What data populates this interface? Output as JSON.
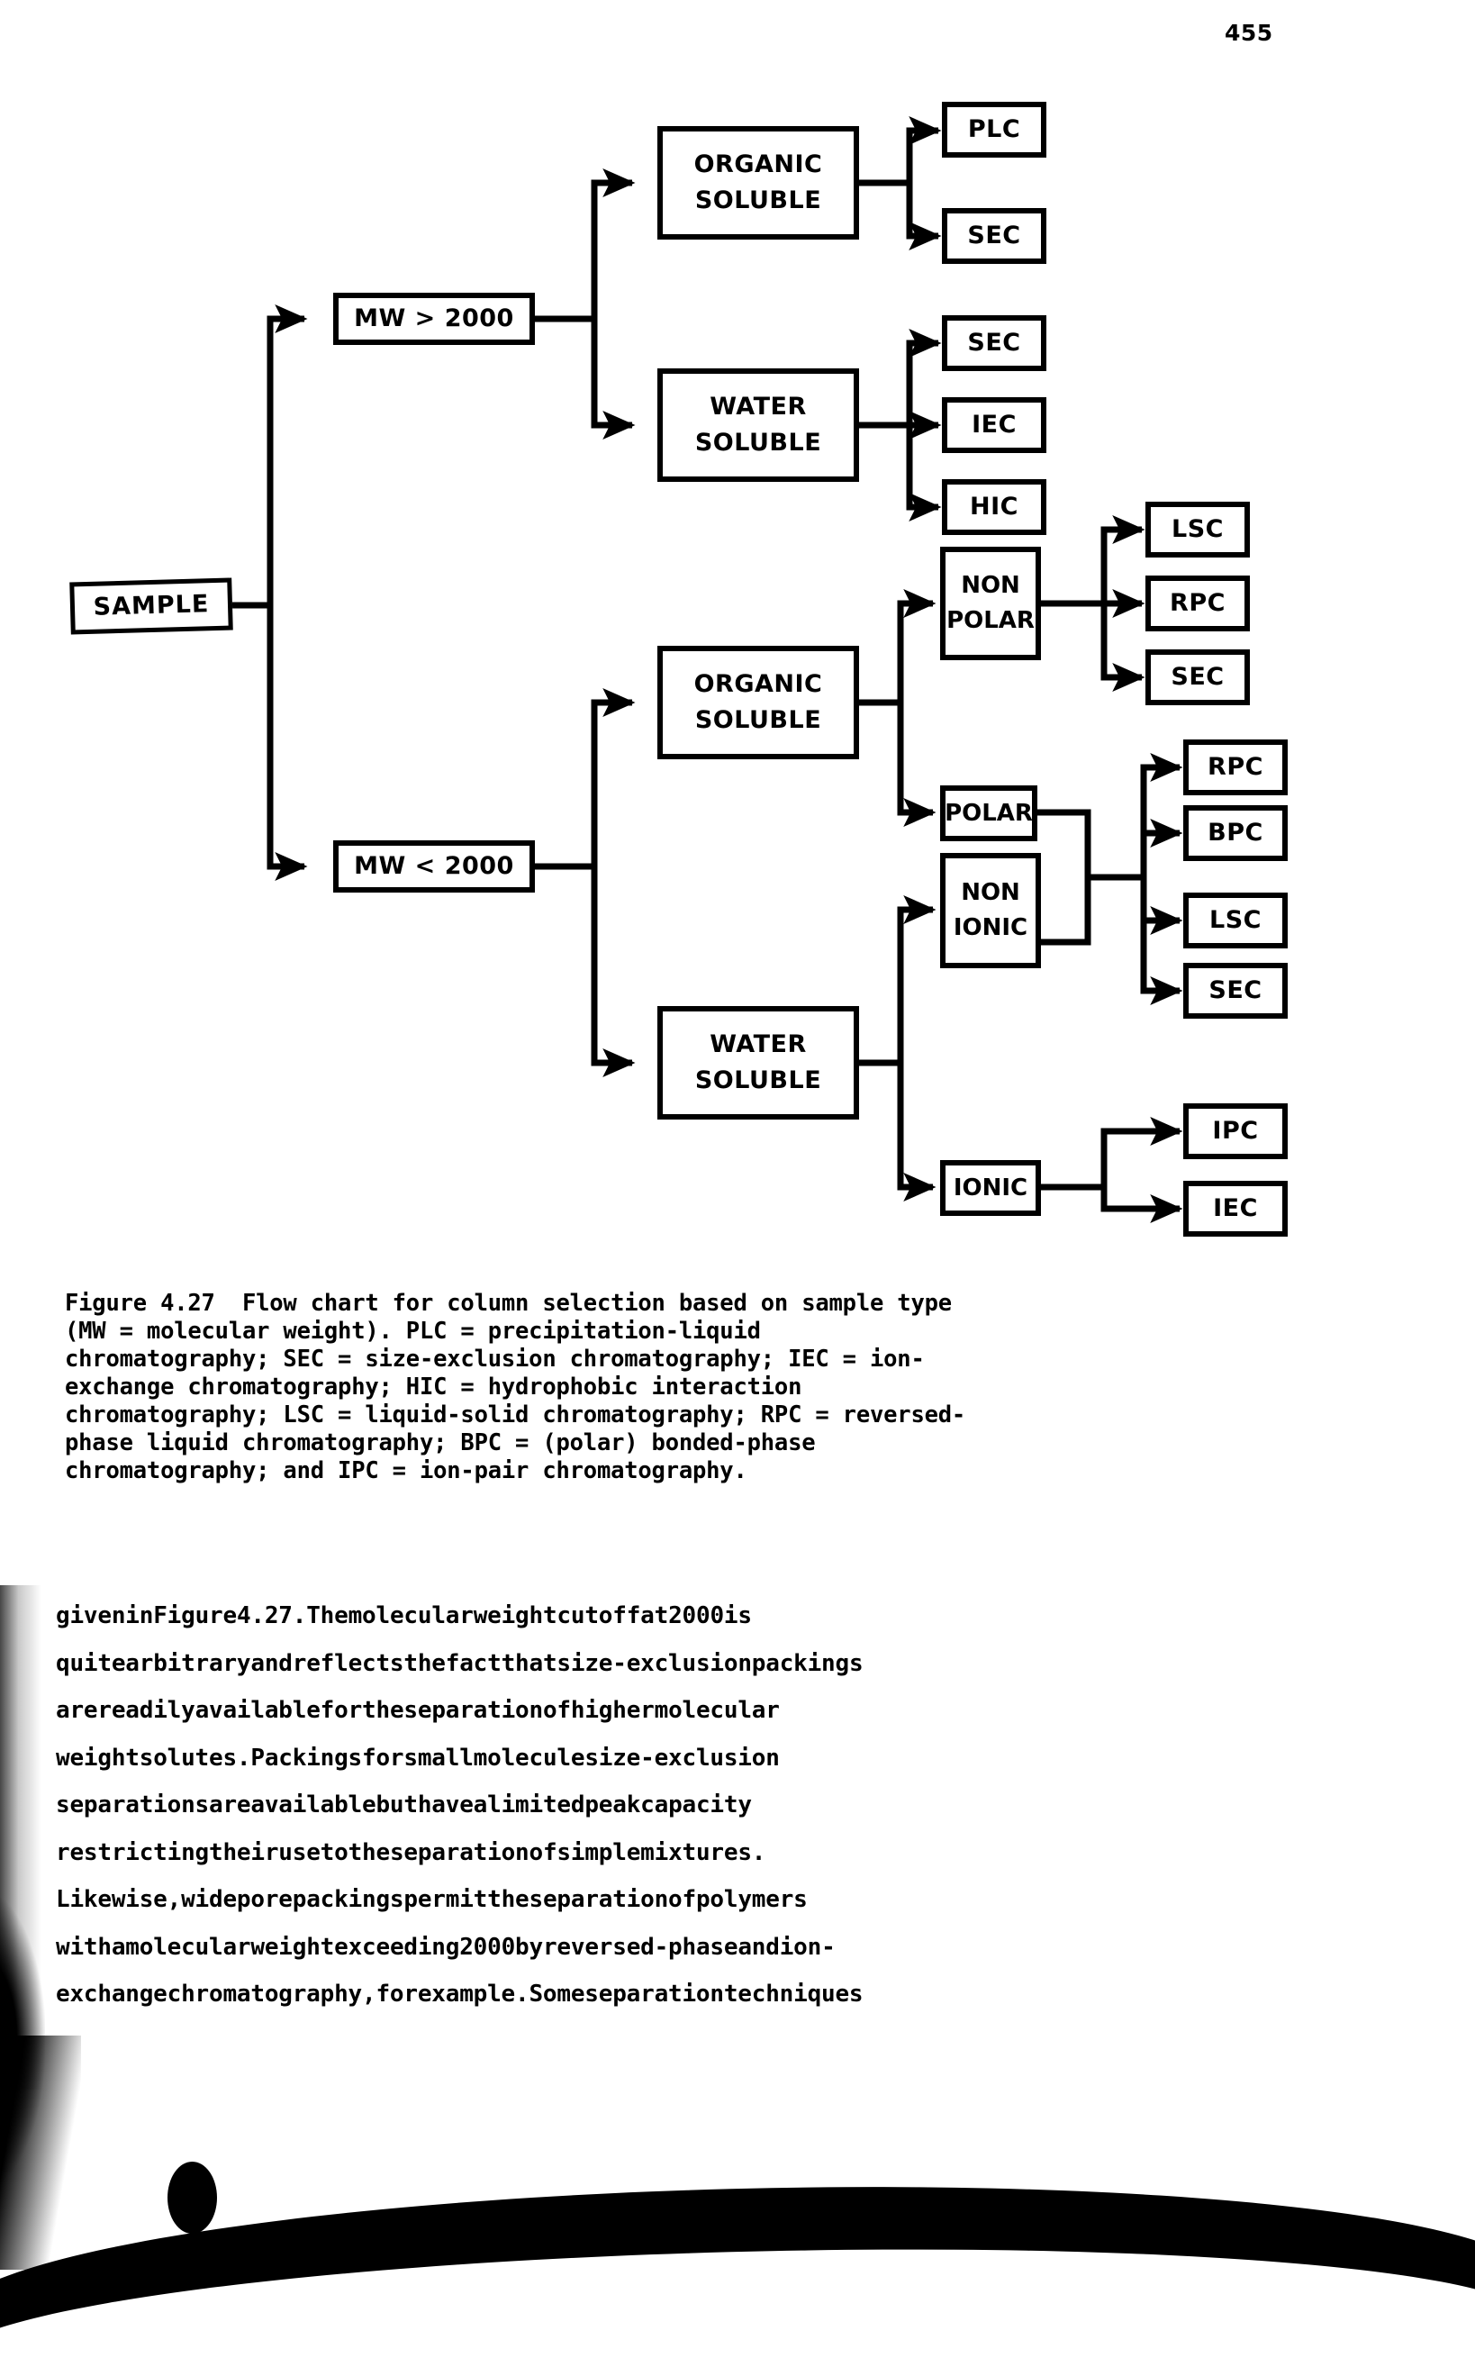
{
  "page": {
    "number": "455"
  },
  "figure": {
    "nodes": {
      "sample": {
        "line1": "SAMPLE",
        "line2": ""
      },
      "mw_gt_2000": {
        "line1": "MW > 2000",
        "line2": ""
      },
      "mw_lt_2000": {
        "line1": "MW < 2000",
        "line2": ""
      },
      "organic_soluble_hi": {
        "line1": "ORGANIC",
        "line2": "SOLUBLE"
      },
      "water_soluble_hi": {
        "line1": "WATER",
        "line2": "SOLUBLE"
      },
      "organic_soluble_lo": {
        "line1": "ORGANIC",
        "line2": "SOLUBLE"
      },
      "water_soluble_lo": {
        "line1": "WATER",
        "line2": "SOLUBLE"
      },
      "non_polar": {
        "line1": "NON",
        "line2": "POLAR"
      },
      "polar": {
        "line1": "POLAR",
        "line2": ""
      },
      "non_ionic": {
        "line1": "NON",
        "line2": "IONIC"
      },
      "ionic": {
        "line1": "IONIC",
        "line2": ""
      },
      "plc": {
        "line1": "PLC",
        "line2": ""
      },
      "sec_1": {
        "line1": "SEC",
        "line2": ""
      },
      "sec_2": {
        "line1": "SEC",
        "line2": ""
      },
      "iec_1": {
        "line1": "IEC",
        "line2": ""
      },
      "hic": {
        "line1": "HIC",
        "line2": ""
      },
      "lsc_1": {
        "line1": "LSC",
        "line2": ""
      },
      "rpc_1": {
        "line1": "RPC",
        "line2": ""
      },
      "sec_3": {
        "line1": "SEC",
        "line2": ""
      },
      "rpc_2": {
        "line1": "RPC",
        "line2": ""
      },
      "bpc": {
        "line1": "BPC",
        "line2": ""
      },
      "lsc_2": {
        "line1": "LSC",
        "line2": ""
      },
      "sec_4": {
        "line1": "SEC",
        "line2": ""
      },
      "ipc": {
        "line1": "IPC",
        "line2": ""
      },
      "iec_2": {
        "line1": "IEC",
        "line2": ""
      }
    }
  },
  "caption": {
    "lines": [
      "Figure 4.27  Flow chart for column selection based on sample type",
      "(MW = molecular weight). PLC = precipitation-liquid",
      "chromatography; SEC = size-exclusion chromatography; IEC = ion-",
      "exchange chromatography; HIC = hydrophobic interaction",
      "chromatography; LSC = liquid-solid chromatography; RPC = reversed-",
      "phase liquid chromatography; BPC = (polar) bonded-phase",
      "chromatography; and IPC = ion-pair chromatography."
    ]
  },
  "body": {
    "lines": [
      [
        "given",
        "in",
        "Figure",
        "4.27.",
        "The",
        "molecular",
        "weight",
        "cut",
        "off",
        "at",
        "2000",
        "is"
      ],
      [
        "quite",
        "arbitrary",
        "and",
        "reflects",
        "the",
        "fact",
        "that",
        "size-exclusion",
        "packings"
      ],
      [
        "are",
        "readily",
        "available",
        "for",
        "the",
        "separation",
        "of",
        "higher",
        "molecular"
      ],
      [
        "weight",
        "solutes.",
        "Packings",
        "for",
        "small",
        "molecule",
        "size-exclusion"
      ],
      [
        "separations",
        "are",
        "available",
        "but",
        "have",
        "a",
        "limited",
        "peak",
        "capacity"
      ],
      [
        "restricting",
        "their",
        "use",
        "to",
        "the",
        "separation",
        "of",
        "simple",
        "mixtures."
      ],
      [
        "Likewise,",
        "wide",
        "pore",
        "packings",
        "permit",
        "the",
        "separation",
        "of",
        "polymers"
      ],
      [
        "with",
        "a",
        "molecular",
        "weight",
        "exceeding",
        "2000",
        "by",
        "reversed-phase",
        "and",
        "ion-"
      ],
      [
        "exchange",
        "chromatography,",
        "for",
        "example.",
        "Some",
        "separation",
        "techniques"
      ]
    ]
  },
  "colors": {
    "ink": "#000000",
    "paper": "#ffffff"
  }
}
